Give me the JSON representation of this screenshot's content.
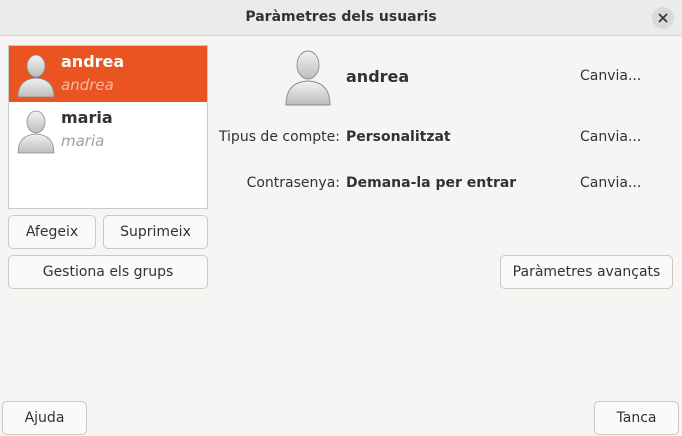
{
  "window": {
    "title": "Paràmetres dels usuaris"
  },
  "users": [
    {
      "username": "andrea",
      "realname": "andrea",
      "selected": true
    },
    {
      "username": "maria",
      "realname": "maria",
      "selected": false
    }
  ],
  "buttons": {
    "add": "Afegeix",
    "remove": "Suprimeix",
    "manage_groups": "Gestiona els grups",
    "advanced": "Paràmetres avançats",
    "help": "Ajuda",
    "close": "Tanca"
  },
  "details": {
    "name": "andrea",
    "name_change": "Canvia...",
    "account_type_label": "Tipus de compte:",
    "account_type_value": "Personalitzat",
    "account_type_change": "Canvia...",
    "password_label": "Contrasenya:",
    "password_value": "Demana-la per entrar",
    "password_change": "Canvia..."
  },
  "icons": {
    "close": "close-icon",
    "avatar": "user-avatar-icon"
  },
  "colors": {
    "selection": "#e95420",
    "background": "#f6f5f4"
  }
}
